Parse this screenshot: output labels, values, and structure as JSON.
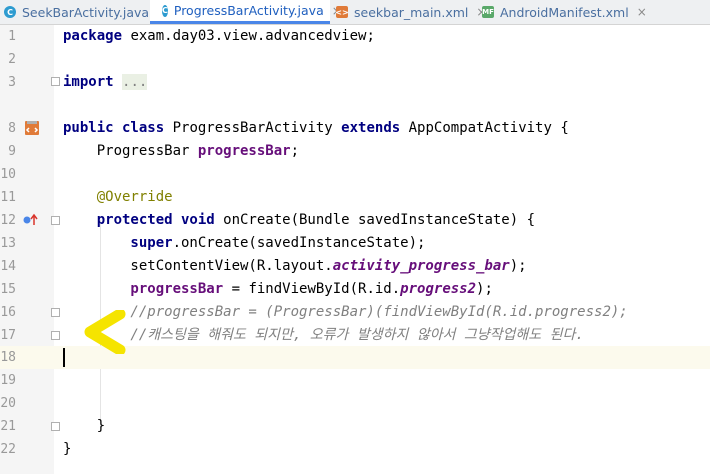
{
  "tabs": [
    {
      "label": "SeekBarActivity.java",
      "icon": "java-class-icon",
      "active": false
    },
    {
      "label": "ProgressBarActivity.java",
      "icon": "java-class-icon",
      "active": true
    },
    {
      "label": "seekbar_main.xml",
      "icon": "xml-file-icon",
      "active": false
    },
    {
      "label": "AndroidManifest.xml",
      "icon": "manifest-file-icon",
      "active": false
    }
  ],
  "tab_icon_text": {
    "java": "C",
    "xml": "<>",
    "mf": "MF"
  },
  "close_glyph": "×",
  "lines": {
    "n1": "1",
    "n2": "2",
    "n3": "3",
    "n8": "8",
    "n9": "9",
    "n10": "10",
    "n11": "11",
    "n12": "12",
    "n13": "13",
    "n14": "14",
    "n15": "15",
    "n16": "16",
    "n17": "17",
    "n18": "18",
    "n19": "19",
    "n20": "20",
    "n21": "21",
    "n22": "22"
  },
  "code": {
    "l1_kw": "package",
    "l1_rest": " exam.day03.view.advancedview;",
    "l3_kw": "import",
    "l3_fold": "...",
    "l8_kw1": "public class",
    "l8_mid": " ProgressBarActivity ",
    "l8_kw2": "extends",
    "l8_rest": " AppCompatActivity {",
    "l9_type": "    ProgressBar ",
    "l9_field": "progressBar",
    "l9_end": ";",
    "l11_ann": "    @Override",
    "l12_kw": "    protected void",
    "l12_rest": " onCreate(Bundle savedInstanceState) {",
    "l13_kw": "        super",
    "l13_rest": ".onCreate(savedInstanceState);",
    "l14_a": "        setContentView(R.layout.",
    "l14_sf": "activity_progress_bar",
    "l14_b": ");",
    "l15_field": "        progressBar",
    "l15_a": " = findViewById(R.id.",
    "l15_sf": "progress2",
    "l15_b": ");",
    "l16_cmt": "        //progressBar = (ProgressBar)(findViewById(R.id.progress2);",
    "l17_cmt": "        //캐스팅을 해줘도 되지만, 오류가 발생하지 않아서 그냥작업해도 된다.",
    "l21": "    }",
    "l22": "}"
  },
  "colors": {
    "keyword": "#000080",
    "field": "#660e7a",
    "annotation": "#808000",
    "comment": "#808080",
    "current_line": "#fcfaed",
    "annotation_mark": "#f5e400"
  }
}
